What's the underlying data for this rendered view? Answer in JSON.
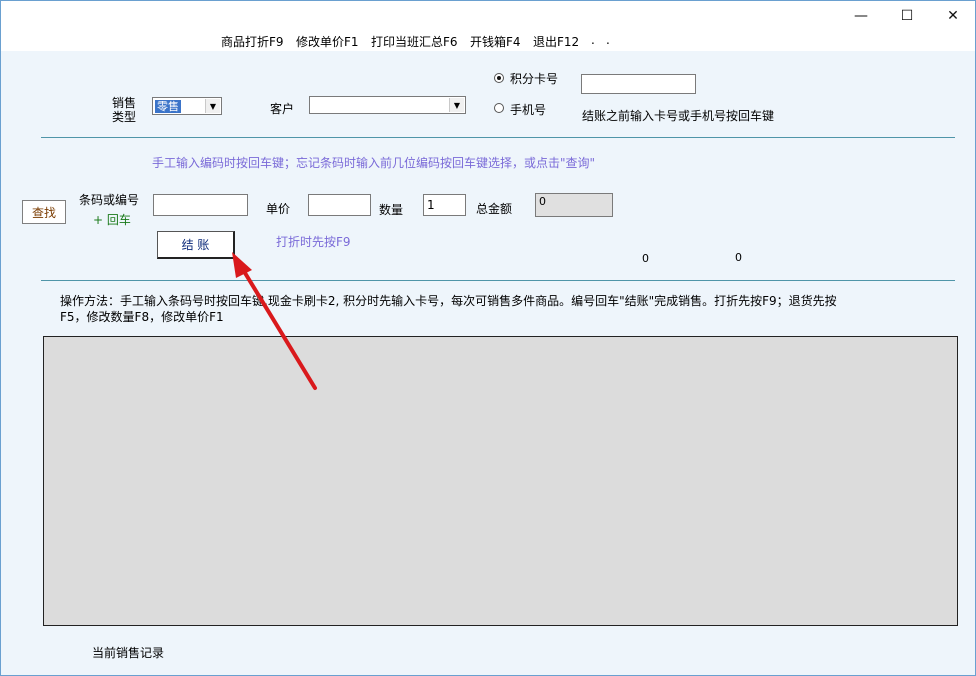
{
  "window": {
    "minimize_glyph": "—",
    "maximize_glyph": "☐",
    "close_glyph": "✕"
  },
  "menu": {
    "items": [
      "商品打折F9",
      "修改单价F1",
      "打印当班汇总F6",
      "开钱箱F4",
      "退出F12",
      ".",
      "."
    ]
  },
  "form": {
    "sales_type_label_1": "销售",
    "sales_type_label_2": "类型",
    "sales_type_value": "零售",
    "customer_label": "客户",
    "customer_value": "",
    "points_card_label": "积分卡号",
    "phone_label": "手机号",
    "card_value": "",
    "card_hint": "结账之前输入卡号或手机号按回车键",
    "manual_hint": "手工输入编码时按回车键；忘记条码时输入前几位编码按回车键选择，或点击\"查询\"",
    "search_button": "查找",
    "barcode_label": "条码或编号",
    "enter_hint": "+ 回车",
    "barcode_value": "",
    "unit_price_label": "单价",
    "unit_price_value": "",
    "quantity_label": "数量",
    "quantity_value": "1",
    "total_label": "总金额",
    "total_value": "0",
    "checkout_button": "结 账",
    "discount_hint": "打折时先按F9",
    "count_a": "0",
    "count_b": "0"
  },
  "instructions": {
    "line1": "操作方法：手工输入条码号时按回车键,现金卡刷卡2,  积分时先输入卡号，每次可销售多件商品。编号回车\"结账\"完成销售。打折先按F9；退货先按",
    "line2": "F5，修改数量F8，修改单价F1"
  },
  "footer": {
    "records_label": "当前销售记录"
  },
  "colors": {
    "background": "#eef5fb",
    "hint_purple": "#7a6ad8",
    "separator": "#4f95a8",
    "arrow_red": "#d9191c",
    "grid_gray": "#dcdcdc"
  }
}
